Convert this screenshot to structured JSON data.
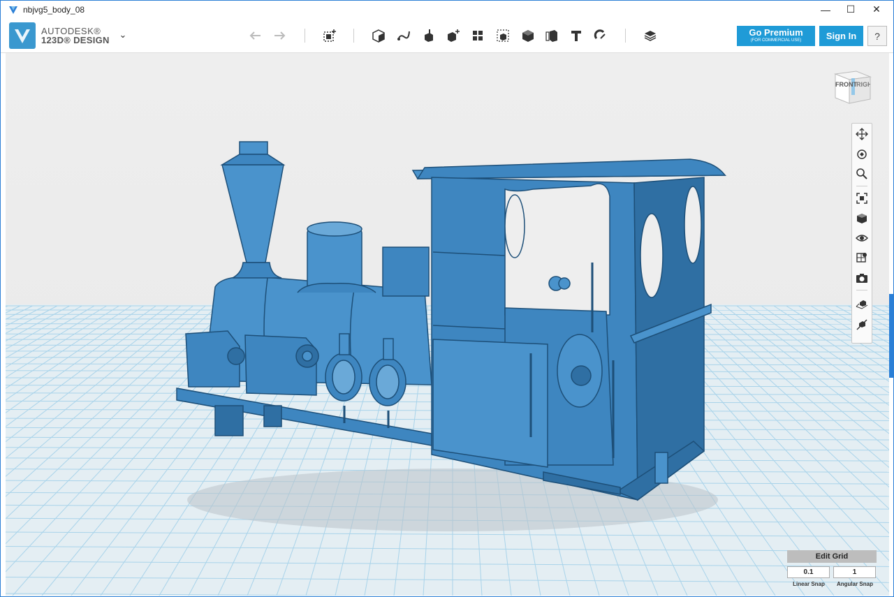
{
  "window": {
    "title": "nbjvg5_body_08",
    "minimize_glyph": "—",
    "maximize_glyph": "☐",
    "close_glyph": "✕"
  },
  "brand": {
    "line1": "AUTODESK®",
    "line2": "123D® DESIGN",
    "menu_glyph": "⌄"
  },
  "toolbar": {
    "tools": [
      "undo-icon",
      "redo-icon",
      "transform-icon",
      "primitives-icon",
      "sketch-icon",
      "construct-icon",
      "modify-icon",
      "pattern-icon",
      "group-icon",
      "combine-icon",
      "measure-icon",
      "text-icon",
      "snap-icon",
      "materials-icon"
    ]
  },
  "account": {
    "premium_label": "Go Premium",
    "premium_sub": "(FOR COMMERCIAL USE)",
    "signin_label": "Sign In",
    "help_label": "?"
  },
  "viewcube": {
    "front": "FRONT",
    "right": "RIGHT"
  },
  "nav_tools": [
    "pan-icon",
    "orbit-icon",
    "zoom-icon",
    "fit-icon",
    "view-icon",
    "visibility-icon",
    "material-icon",
    "screenshot-icon",
    "snap-grid-icon",
    "hide-grid-icon"
  ],
  "grid_panel": {
    "title": "Edit Grid",
    "linear_value": "0.1",
    "angular_value": "1",
    "linear_label": "Linear Snap",
    "angular_label": "Angular Snap"
  },
  "colors": {
    "accent": "#1f9bd7",
    "model": "#3e86c0",
    "grid_bg": "#e6f0f5",
    "grid_line": "#9fd0ea"
  }
}
